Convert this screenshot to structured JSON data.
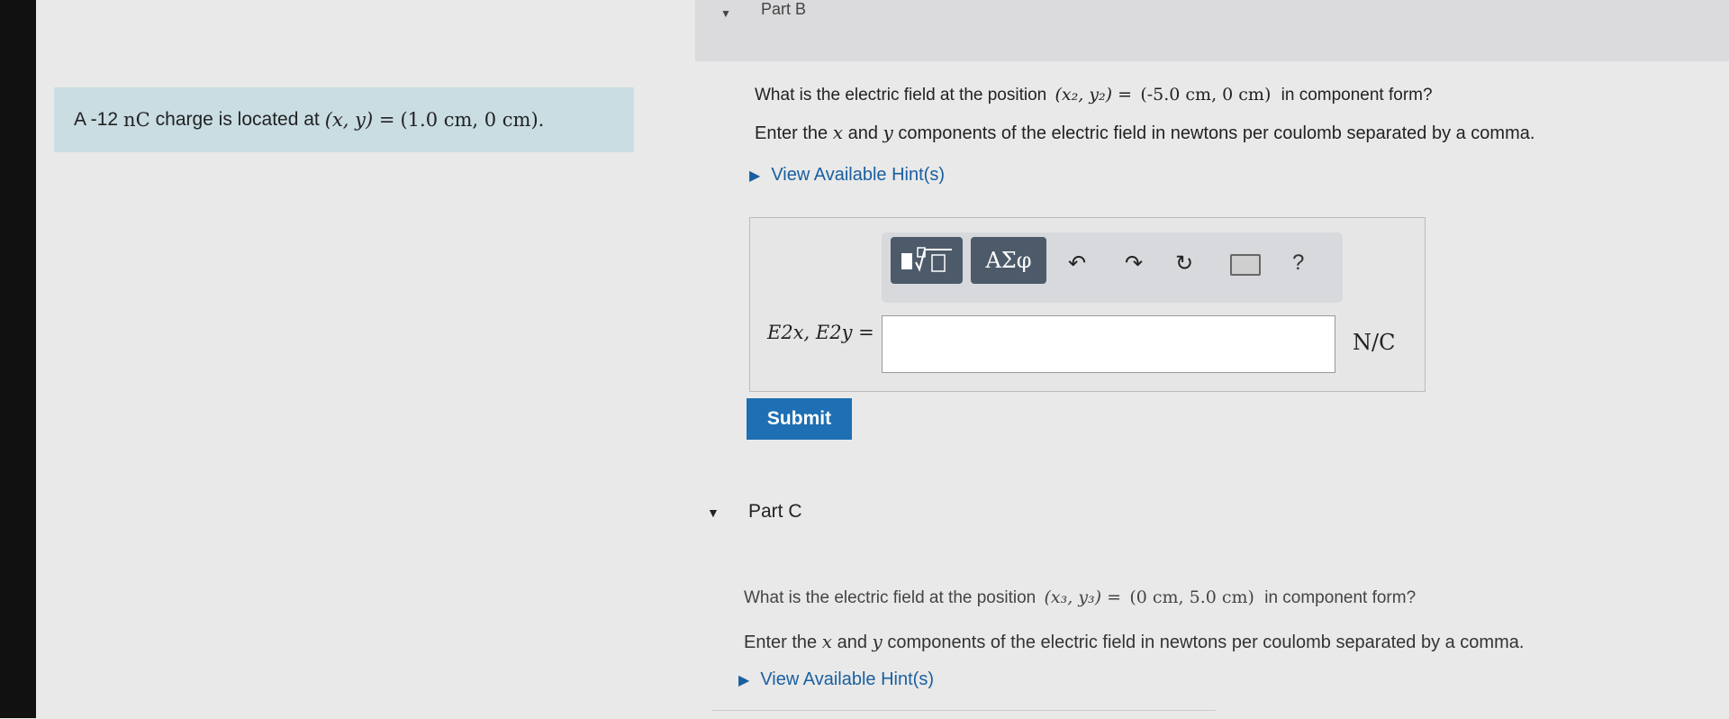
{
  "part_b": {
    "title": "Part B",
    "question_prefix": "What is the electric field at the position",
    "question_tuple": "(x₂, y₂) =",
    "question_value": "(-5.0 cm, 0 cm)",
    "question_suffix": "in component form?",
    "instruction_prefix": "Enter the",
    "instruction_x": "x",
    "instruction_and": "and",
    "instruction_y": "y",
    "instruction_suffix": "components of the electric field in newtons per coulomb separated by a comma.",
    "hint_label": "View Available Hint(s)",
    "answer_label": "E2x, E2y =",
    "answer_value": "",
    "unit": "N/C",
    "submit_label": "Submit"
  },
  "problem": {
    "prefix": "A -12",
    "charge_unit": "nC",
    "middle": "charge is located at",
    "tuple": "(x, y) =",
    "value": "(1.0 cm, 0 cm)."
  },
  "toolbar": {
    "greek_label": "ΑΣφ",
    "help_label": "?"
  },
  "part_c": {
    "title": "Part C",
    "question_prefix": "What is the electric field at the position",
    "question_tuple": "(x₃, y₃) =",
    "question_value": "(0 cm, 5.0 cm)",
    "question_suffix": "in component form?",
    "instruction_prefix": "Enter the",
    "instruction_x": "x",
    "instruction_and": "and",
    "instruction_y": "y",
    "instruction_suffix": "components of the electric field in newtons per coulomb separated by a comma.",
    "hint_label": "View Available Hint(s)"
  },
  "colors": {
    "problem_bg": "#c9dde3",
    "link": "#1a5fa0",
    "submit_bg": "#1e6fb3"
  }
}
